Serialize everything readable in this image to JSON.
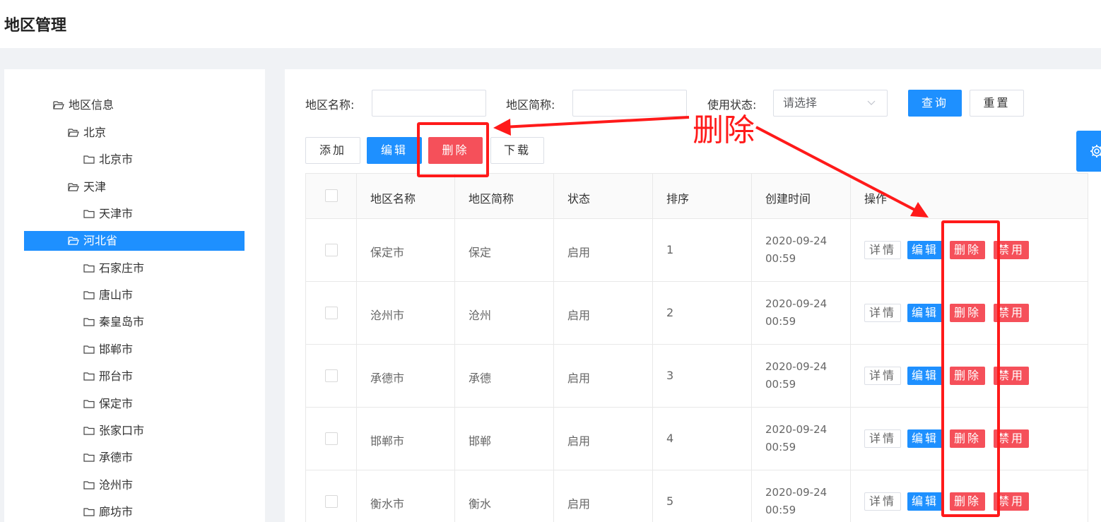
{
  "page": {
    "title": "地区管理"
  },
  "tree": {
    "root": "地区信息",
    "nodes": [
      {
        "label": "北京"
      },
      {
        "label": "北京市"
      },
      {
        "label": "天津"
      },
      {
        "label": "天津市"
      },
      {
        "label": "河北省",
        "selected": true
      },
      {
        "label": "石家庄市"
      },
      {
        "label": "唐山市"
      },
      {
        "label": "秦皇岛市"
      },
      {
        "label": "邯郸市"
      },
      {
        "label": "邢台市"
      },
      {
        "label": "保定市"
      },
      {
        "label": "张家口市"
      },
      {
        "label": "承德市"
      },
      {
        "label": "沧州市"
      },
      {
        "label": "廊坊市"
      }
    ]
  },
  "search": {
    "name_label": "地区名称:",
    "name_value": "",
    "abbr_label": "地区简称:",
    "abbr_value": "",
    "status_label": "使用状态:",
    "status_placeholder": "请选择",
    "query_button": "查询",
    "reset_button": "重置"
  },
  "toolbar": {
    "add": "添加",
    "edit": "编辑",
    "delete": "删除",
    "download": "下载"
  },
  "table": {
    "columns": [
      "地区名称",
      "地区简称",
      "状态",
      "排序",
      "创建时间",
      "操作"
    ],
    "rows": [
      {
        "name": "保定市",
        "abbr": "保定",
        "status": "启用",
        "order": "1",
        "date": "2020-09-24",
        "time": "00:59"
      },
      {
        "name": "沧州市",
        "abbr": "沧州",
        "status": "启用",
        "order": "2",
        "date": "2020-09-24",
        "time": "00:59"
      },
      {
        "name": "承德市",
        "abbr": "承德",
        "status": "启用",
        "order": "3",
        "date": "2020-09-24",
        "time": "00:59"
      },
      {
        "name": "邯郸市",
        "abbr": "邯郸",
        "status": "启用",
        "order": "4",
        "date": "2020-09-24",
        "time": "00:59"
      },
      {
        "name": "衡水市",
        "abbr": "衡水",
        "status": "启用",
        "order": "5",
        "date": "2020-09-24",
        "time": "00:59"
      }
    ],
    "actions": {
      "detail": "详情",
      "edit": "编辑",
      "delete": "删除",
      "disable": "禁用"
    }
  },
  "annotation": {
    "text": "删除",
    "color": "#ff1a1a"
  },
  "colors": {
    "primary": "#1e90ff",
    "danger": "#f5505a"
  },
  "icons": {
    "tree": "folder-icon",
    "select": "chevron-down-icon",
    "settings": "gear-icon"
  }
}
